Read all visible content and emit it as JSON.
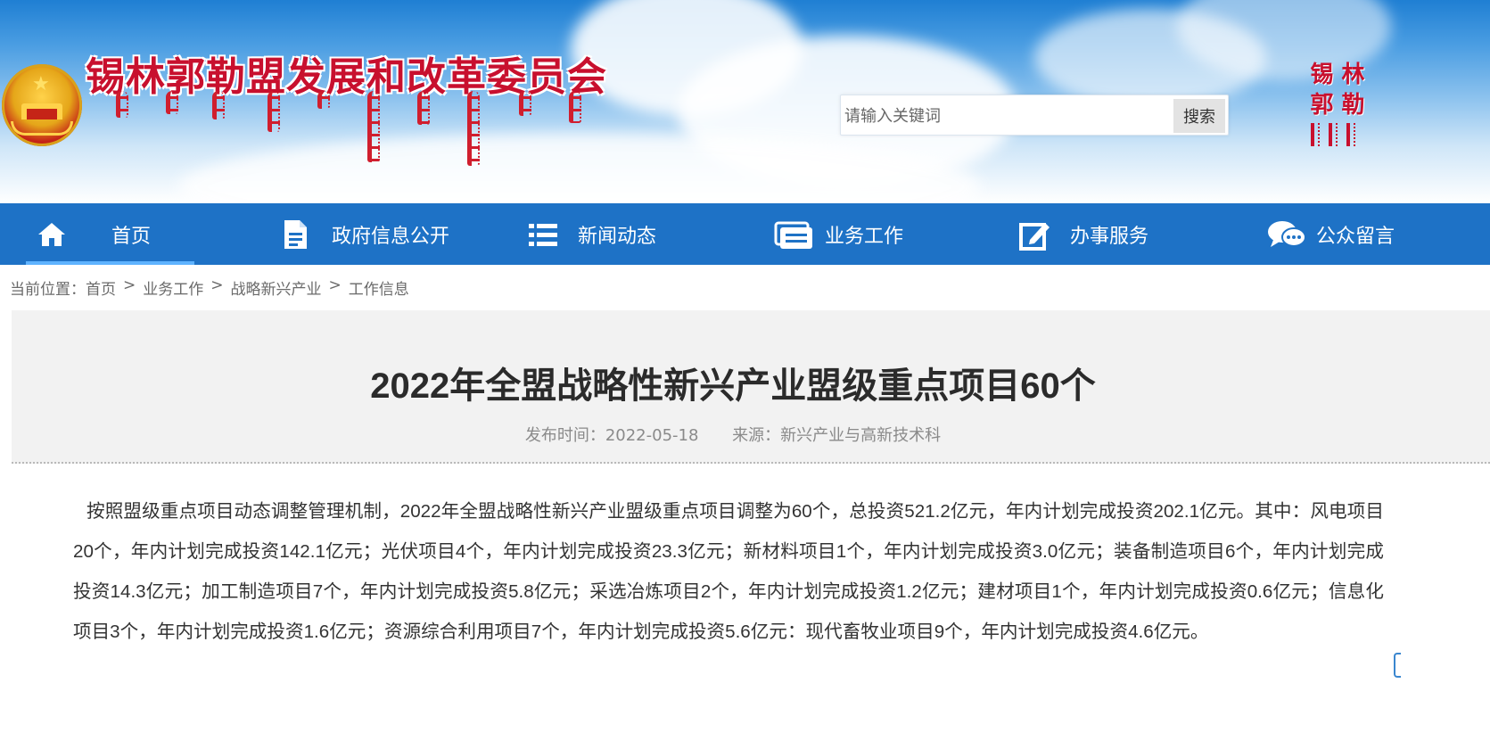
{
  "header": {
    "site_title": "锡林郭勒盟发展和改革委员会",
    "search": {
      "placeholder": "请输入关键词",
      "button_label": "搜索"
    },
    "seal_chars": [
      "锡",
      "林",
      "郭",
      "勒"
    ]
  },
  "nav": {
    "items": [
      {
        "label": "首页",
        "icon": "home-icon",
        "active": true
      },
      {
        "label": "政府信息公开",
        "icon": "document-icon",
        "active": false
      },
      {
        "label": "新闻动态",
        "icon": "list-icon",
        "active": false
      },
      {
        "label": "业务工作",
        "icon": "stacked-cards-icon",
        "active": false
      },
      {
        "label": "办事服务",
        "icon": "edit-icon",
        "active": false
      },
      {
        "label": "公众留言",
        "icon": "chat-bubbles-icon",
        "active": false
      }
    ]
  },
  "breadcrumb": {
    "prefix": "当前位置：",
    "items": [
      "首页",
      "业务工作",
      "战略新兴产业",
      "工作信息"
    ],
    "separator": ">"
  },
  "article": {
    "title": "2022年全盟战略性新兴产业盟级重点项目60个",
    "publish_time": "发布时间：2022-05-18",
    "source": "来源：新兴产业与高新技术科",
    "body": "按照盟级重点项目动态调整管理机制，2022年全盟战略性新兴产业盟级重点项目调整为60个，总投资521.2亿元，年内计划完成投资202.1亿元。其中：风电项目20个，年内计划完成投资142.1亿元；光伏项目4个，年内计划完成投资23.3亿元；新材料项目1个，年内计划完成投资3.0亿元；装备制造项目6个，年内计划完成投资14.3亿元；加工制造项目7个，年内计划完成投资5.8亿元；采选冶炼项目2个，年内计划完成投资1.2亿元；建材项目1个，年内计划完成投资0.6亿元；信息化项目3个，年内计划完成投资1.6亿元；资源综合利用项目7个，年内计划完成投资5.6亿元：现代畜牧业项目9个，年内计划完成投资4.6亿元。"
  },
  "colors": {
    "nav_bg": "#1e72c6",
    "title_red": "#c8102e",
    "article_head_bg": "#f2f2f2"
  }
}
